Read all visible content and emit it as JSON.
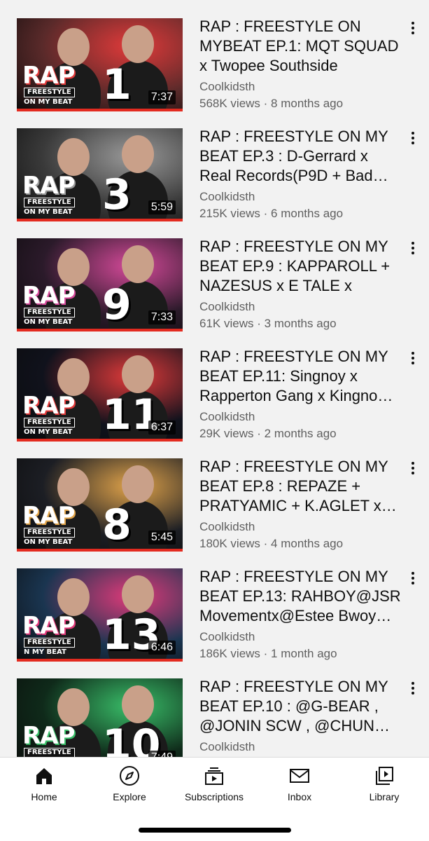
{
  "feed": {
    "videos": [
      {
        "title": "RAP : FREESTYLE ON MYBEAT EP.1: MQT SQUAD x Twopee Southside",
        "channel": "Coolkidsth",
        "meta": "568K views · 8 months ago",
        "duration": "7:37",
        "thumb": {
          "rap": "RAP",
          "freestyle": "FREESTYLE",
          "onmybeat": "ON MY BEAT",
          "ep": "1",
          "bg": "#5a2a2a",
          "accent": "#e23a3a"
        }
      },
      {
        "title": "RAP : FREESTYLE ON MY BEAT EP.3 : D-Gerrard x Real Records(P9D + Bad…",
        "channel": "Coolkidsth",
        "meta": "215K views · 6 months ago",
        "duration": "5:59",
        "thumb": {
          "rap": "RAP",
          "freestyle": "FREESTYLE",
          "onmybeat": "ON MY BEAT",
          "ep": "3",
          "bg": "#3a3a3a",
          "accent": "#9a9a9a"
        }
      },
      {
        "title": "RAP : FREESTYLE ON MY BEAT EP.9 : KAPPAROLL + NAZESUS x E TALE x KEE…",
        "channel": "Coolkidsth",
        "meta": "61K views · 3 months ago",
        "duration": "7:33",
        "thumb": {
          "rap": "RAP",
          "freestyle": "FREESTYLE",
          "onmybeat": "ON MY BEAT",
          "ep": "9",
          "bg": "#2b1a2a",
          "accent": "#d64a9a"
        }
      },
      {
        "title": "RAP : FREESTYLE ON MY BEAT EP.11: Singnoy x Rapperton Gang x Kingno…",
        "channel": "Coolkidsth",
        "meta": "29K views · 2 months ago",
        "duration": "6:37",
        "thumb": {
          "rap": "RAP",
          "freestyle": "FREESTYLE",
          "onmybeat": "ON MY BEAT",
          "ep": "11",
          "bg": "#10121c",
          "accent": "#e23a3a"
        }
      },
      {
        "title": "RAP : FREESTYLE ON MY BEAT EP.8 : REPAZE + PRATYAMIC + K.AGLET x…",
        "channel": "Coolkidsth",
        "meta": "180K views · 4 months ago",
        "duration": "5:45",
        "thumb": {
          "rap": "RAP",
          "freestyle": "FREESTYLE",
          "onmybeat": "ON MY BEAT",
          "ep": "8",
          "bg": "#1c1e24",
          "accent": "#e2a44a"
        }
      },
      {
        "title": "RAP : FREESTYLE ON MY BEAT EP.13: RAHBOY@JSR Movementx@Estee Bwoy…",
        "channel": "Coolkidsth",
        "meta": "186K views · 1 month ago",
        "duration": "6:46",
        "thumb": {
          "rap": "RAP",
          "freestyle": "FREESTYLE",
          "onmybeat": "N MY BEAT",
          "ep": "13",
          "bg": "#1a3550",
          "accent": "#e23a7a"
        }
      },
      {
        "title": "RAP : FREESTYLE ON MY BEAT EP.10 : @G-BEAR , @JONIN SCW , @CHUN…",
        "channel": "Coolkidsth",
        "meta": "",
        "duration": "7:49",
        "thumb": {
          "rap": "RAP",
          "freestyle": "FREESTYLE",
          "onmybeat": "",
          "ep": "10",
          "bg": "#0f2a1a",
          "accent": "#3ac06a"
        }
      }
    ]
  },
  "bottom_nav": {
    "items": [
      {
        "label": "Home",
        "icon": "home-icon"
      },
      {
        "label": "Explore",
        "icon": "compass-icon"
      },
      {
        "label": "Subscriptions",
        "icon": "subscriptions-icon"
      },
      {
        "label": "Inbox",
        "icon": "mail-icon"
      },
      {
        "label": "Library",
        "icon": "library-icon"
      }
    ]
  }
}
